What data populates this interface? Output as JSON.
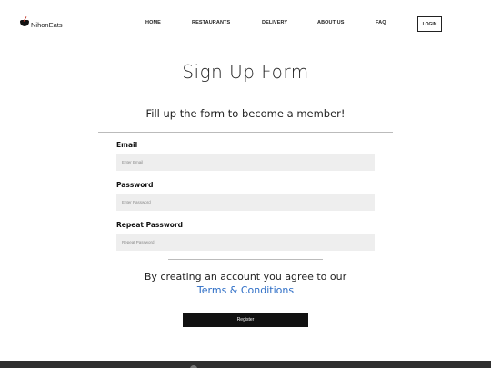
{
  "brand": {
    "name": "NihonEats",
    "icon": "sushi-bowl-icon"
  },
  "nav": {
    "items": [
      {
        "label": "HOME"
      },
      {
        "label": "RESTAURANTS"
      },
      {
        "label": "DELIVERY"
      },
      {
        "label": "ABOUT US"
      },
      {
        "label": "FAQ"
      }
    ],
    "login_label": "LOGIN"
  },
  "page": {
    "title": "Sign Up Form",
    "subtitle": "Fill up the form to become a member!"
  },
  "form": {
    "email": {
      "label": "Email",
      "placeholder": "Enter Email"
    },
    "password": {
      "label": "Password",
      "placeholder": "Enter Password"
    },
    "repeat_password": {
      "label": "Repeat Password",
      "placeholder": "Repeat Password"
    },
    "terms_text": "By creating an account you agree to our",
    "terms_link": "Terms & Conditions",
    "register_label": "Register"
  },
  "colors": {
    "accent_link": "#2e6ec6",
    "button_bg": "#111111",
    "input_bg": "#eeeeee",
    "footer_bg": "#2f2f2f"
  }
}
